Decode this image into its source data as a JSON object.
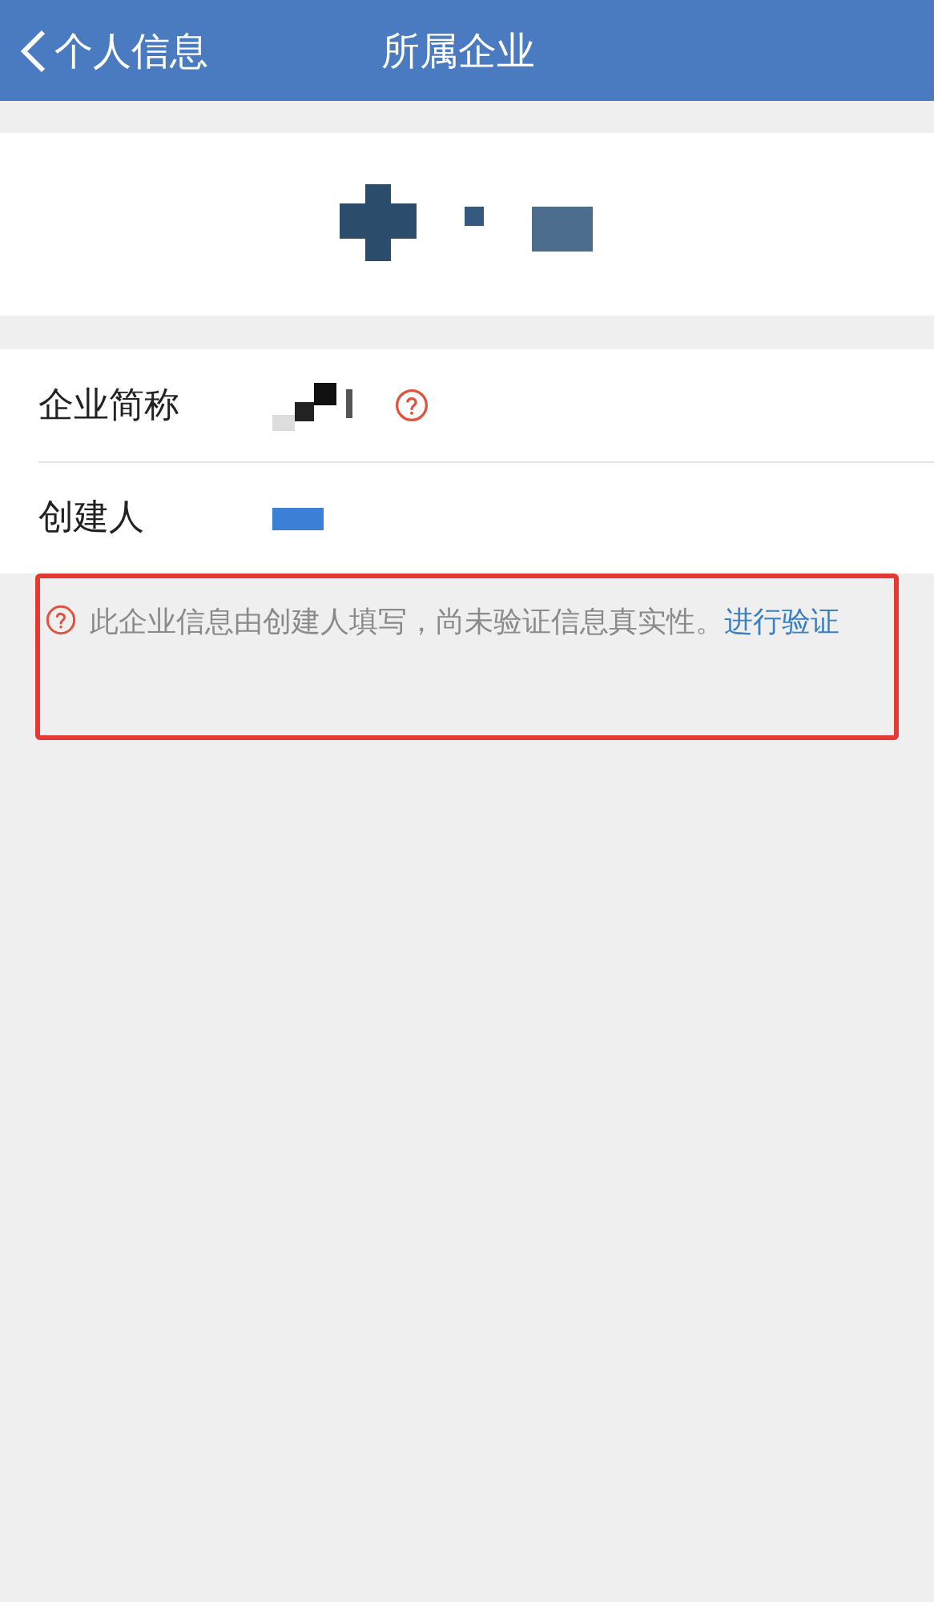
{
  "nav_bar": {
    "back_label": "个人信息",
    "title": "所属企业"
  },
  "company_card": {
    "kind": "redacted"
  },
  "fields": [
    {
      "label": "企业简称",
      "kind": "redacted_with_help"
    },
    {
      "label": "创建人",
      "kind": "redacted_bar"
    }
  ],
  "notice": {
    "text": "此企业信息由创建人填写，尚未验证信息真实性。",
    "link": "进行验证",
    "highlighted": true
  }
}
